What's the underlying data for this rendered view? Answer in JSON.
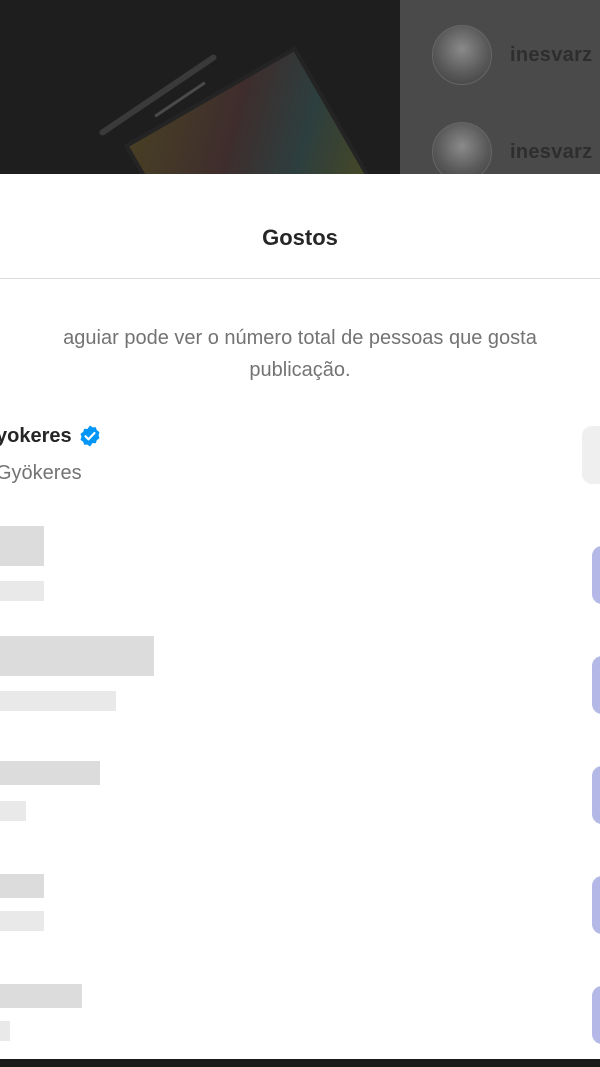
{
  "background": {
    "comments": [
      {
        "username": "inesvarz"
      },
      {
        "username": "inesvarz"
      }
    ]
  },
  "modal": {
    "title": "Gostos",
    "notice_line1": "aguiar pode ver o número total de pessoas que gosta",
    "notice_line2": "publicação.",
    "likes": [
      {
        "name": "yokeres",
        "subtitle": "Gyökeres",
        "verified": true,
        "follow_color": "#efefef"
      },
      {
        "blurred": true,
        "follow_color": "#b3b8e6"
      },
      {
        "blurred": true,
        "follow_color": "#b3b8e6"
      },
      {
        "blurred": true,
        "follow_color": "#b3b8e6"
      },
      {
        "blurred": true,
        "follow_color": "#b3b8e6"
      },
      {
        "blurred": true,
        "follow_color": "#b3b8e6"
      }
    ]
  },
  "colors": {
    "verified_badge": "#0095f6",
    "title_text": "#262626",
    "secondary_text": "#737373"
  }
}
